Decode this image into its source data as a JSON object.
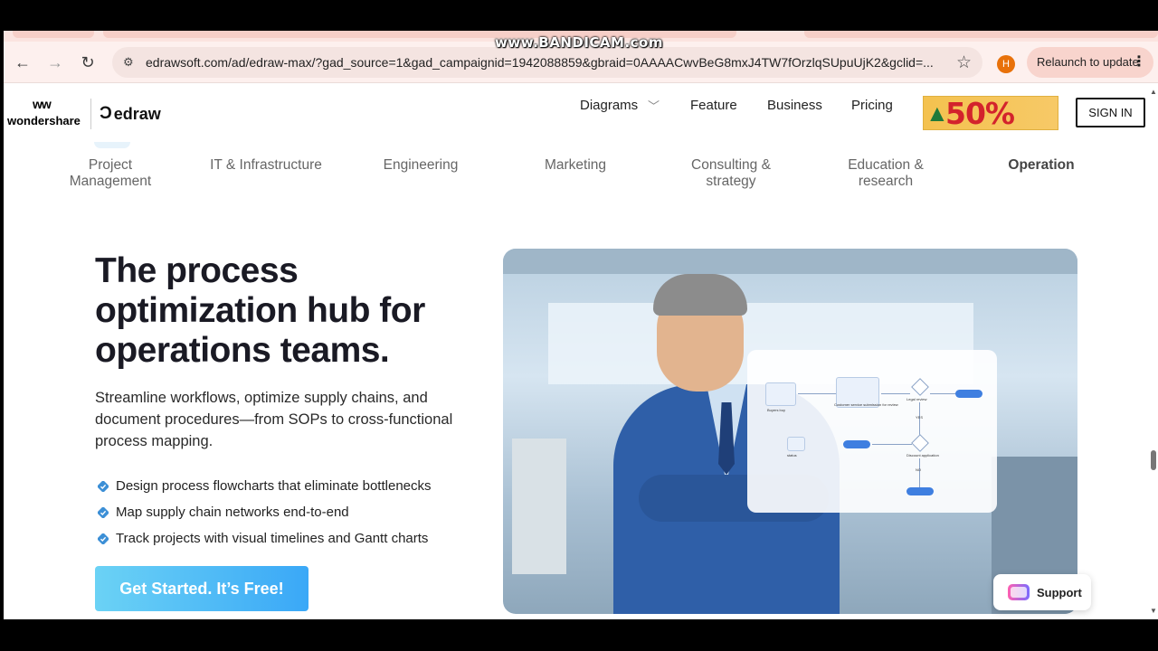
{
  "watermark": "www.BANDICAM.com",
  "browser": {
    "url": "edrawsoft.com/ad/edraw-max/?gad_source=1&gad_campaignid=1942088859&gbraid=0AAAACwvBeG8mxJ4TW7fOrzlqSUpuUjK2&gclid=...",
    "profile_initial": "H",
    "relaunch_label": "Relaunch to update",
    "back_icon": "←",
    "forward_icon": "→",
    "reload_icon": "↻",
    "star_icon": "☆",
    "menu_icon": "⋮",
    "site_info_icon": "⚙"
  },
  "header": {
    "wondershare_label": "wondershare",
    "wondershare_mark": "ww",
    "edraw_label": "edraw",
    "edraw_mark": "Ɔ",
    "nav": {
      "diagrams": "Diagrams",
      "diagrams_chevron": "﹀",
      "feature": "Feature",
      "business": "Business",
      "pricing": "Pricing"
    },
    "promo_text": "50%",
    "promo_tree": "▲",
    "signin_label": "SIGN IN"
  },
  "categories": {
    "pm": "Project Management",
    "it": "IT & Infrastructure",
    "eng": "Engineering",
    "mkt": "Marketing",
    "cons": "Consulting & strategy",
    "edu": "Education & research",
    "op": "Operation"
  },
  "hero": {
    "title": "The process optimization hub for operations teams.",
    "subtitle": "Streamline workflows, optimize supply chains, and document procedures—from SOPs to cross-functional process mapping.",
    "bullets": [
      "Design process flowcharts that eliminate bottlenecks",
      "Map supply chain networks end-to-end",
      "Track projects with visual timelines and Gantt charts"
    ],
    "cta_label": "Get Started. It’s Free!"
  },
  "flowchart_labels": {
    "buyers": "Buyers buy",
    "customer": "Customer service submission for review",
    "legal": "Legal review",
    "approval": "Discount application",
    "yes": "YES",
    "no": "NO",
    "status": "status"
  },
  "support_label": "Support",
  "colors": {
    "cta_start": "#6bd2f5",
    "cta_end": "#3aa8f7",
    "promo_red": "#d3232c",
    "profile": "#e8710a"
  }
}
